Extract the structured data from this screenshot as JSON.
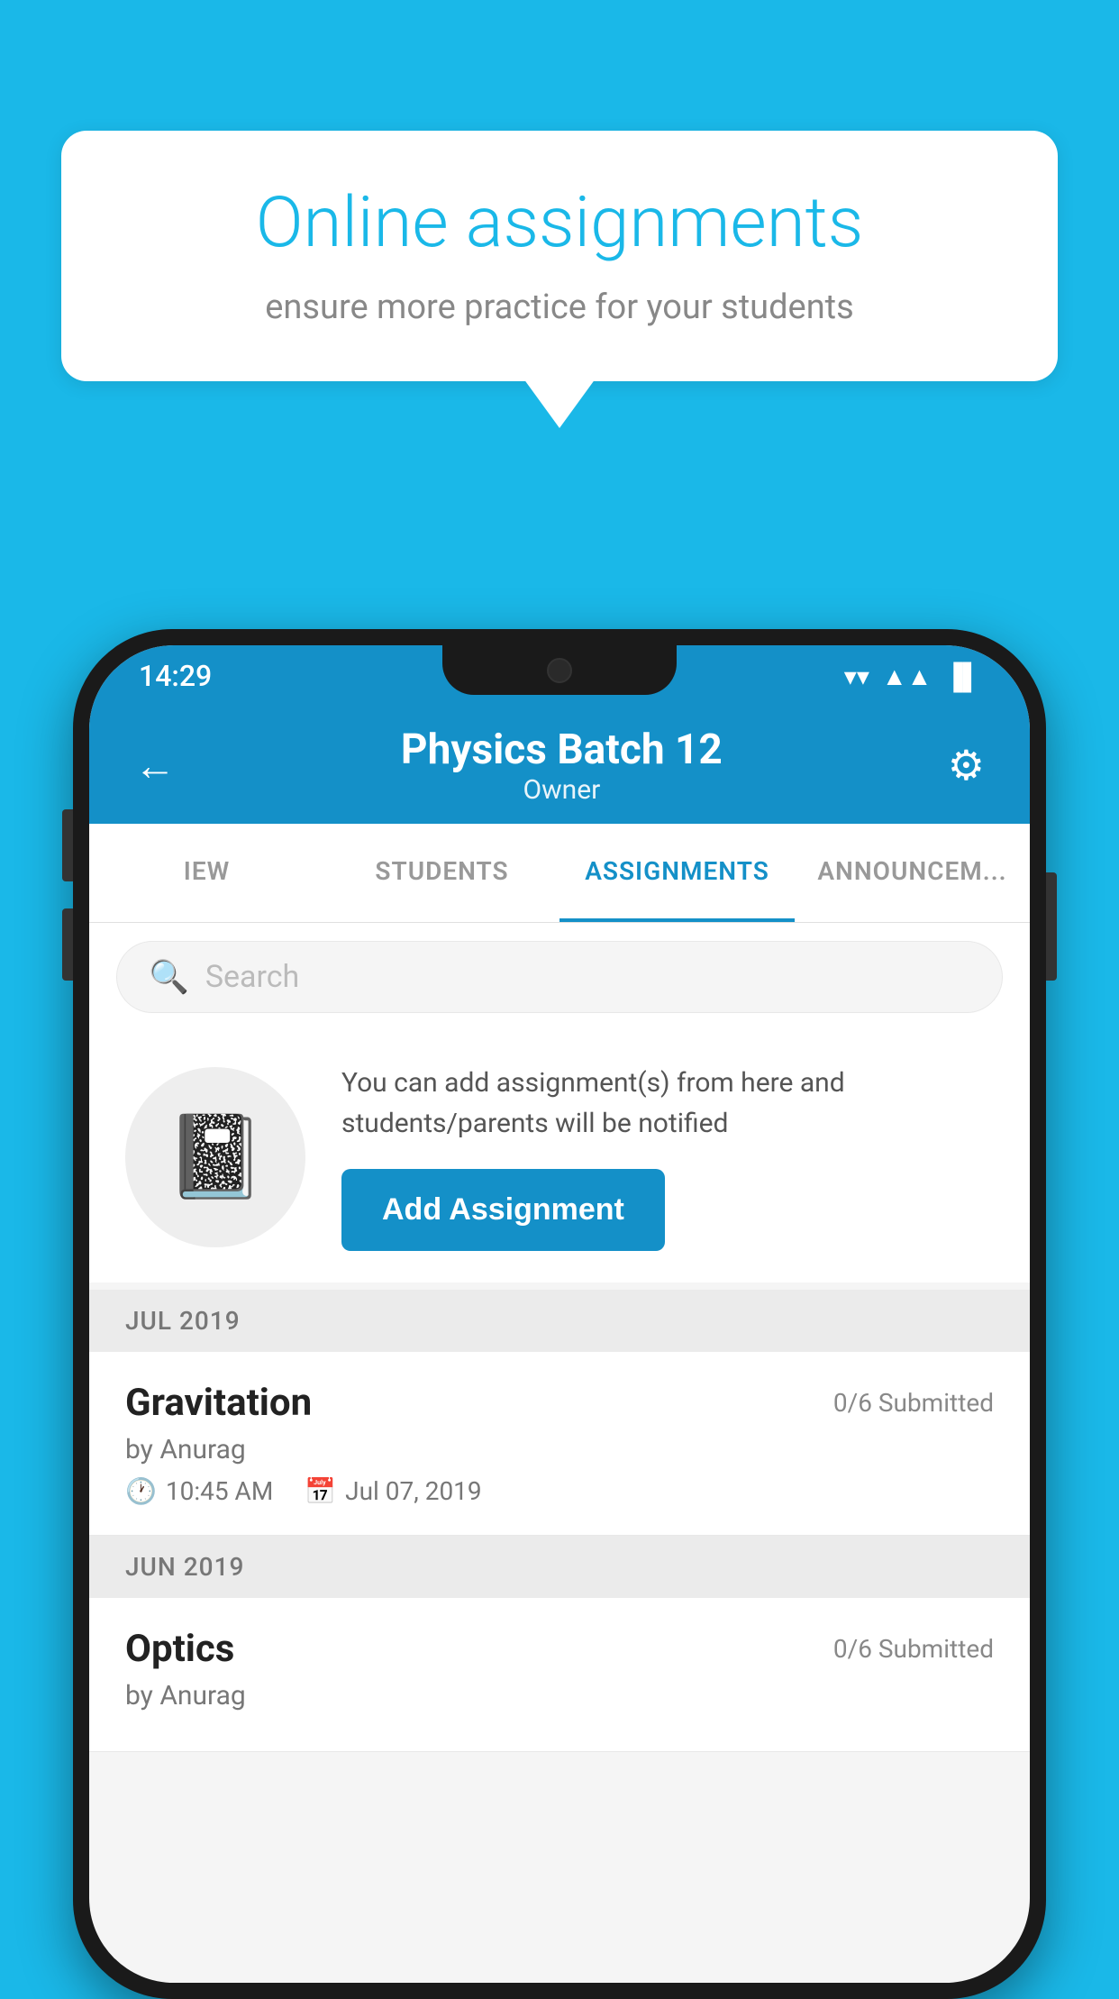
{
  "background": {
    "color": "#1ab8e8"
  },
  "speech_bubble": {
    "title": "Online assignments",
    "subtitle": "ensure more practice for your students"
  },
  "status_bar": {
    "time": "14:29",
    "wifi": "▼",
    "signal": "▲",
    "battery": "▌"
  },
  "header": {
    "title": "Physics Batch 12",
    "subtitle": "Owner",
    "back_label": "←",
    "settings_label": "⚙"
  },
  "tabs": [
    {
      "label": "IEW",
      "active": false
    },
    {
      "label": "STUDENTS",
      "active": false
    },
    {
      "label": "ASSIGNMENTS",
      "active": true
    },
    {
      "label": "ANNOUNCEM...",
      "active": false
    }
  ],
  "search": {
    "placeholder": "Search"
  },
  "promo": {
    "text": "You can add assignment(s) from here and students/parents will be notified",
    "button_label": "Add Assignment"
  },
  "sections": [
    {
      "label": "JUL 2019",
      "assignments": [
        {
          "name": "Gravitation",
          "submitted": "0/6 Submitted",
          "author": "by Anurag",
          "time": "10:45 AM",
          "date": "Jul 07, 2019"
        }
      ]
    },
    {
      "label": "JUN 2019",
      "assignments": [
        {
          "name": "Optics",
          "submitted": "0/6 Submitted",
          "author": "by Anurag",
          "time": "",
          "date": ""
        }
      ]
    }
  ]
}
